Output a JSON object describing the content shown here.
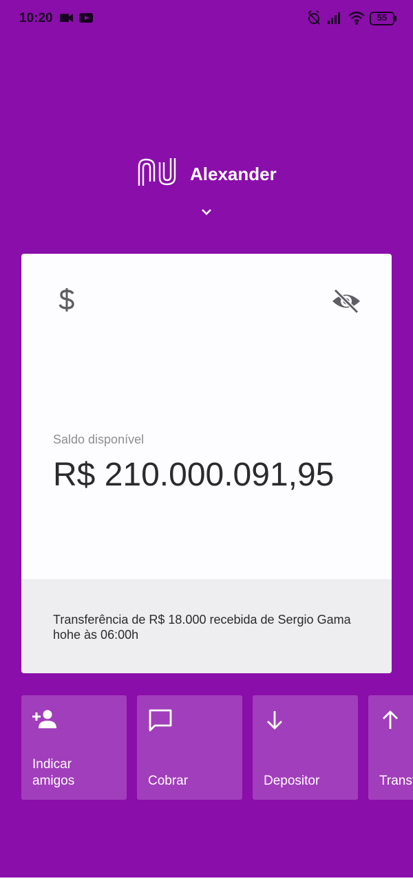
{
  "status_bar": {
    "time": "10:20",
    "battery": "55",
    "icons": [
      "video-camera-icon",
      "youtube-icon",
      "alarm-off-icon",
      "signal-icon",
      "wifi-icon",
      "battery-icon"
    ]
  },
  "header": {
    "user_name": "Alexander",
    "logo": "nu-logo",
    "expand_icon": "chevron-down-icon"
  },
  "account_card": {
    "icon": "dollar-icon",
    "visibility_icon": "eye-off-icon",
    "balance_label": "Saldo disponível",
    "balance_value": "R$ 210.000.091,95",
    "notification": "Transferência de R$ 18.000 recebida de Sergio Gama hohe às 06:00h"
  },
  "actions": [
    {
      "label": "Indicar\namigos",
      "icon": "person-add-icon"
    },
    {
      "label": "Cobrar",
      "icon": "chat-icon"
    },
    {
      "label": "Depositor",
      "icon": "arrow-down-icon"
    },
    {
      "label": "Transferir",
      "icon": "arrow-up-icon"
    }
  ],
  "colors": {
    "brand_purple": "#8a0eaa",
    "card_bg": "#fdfcfe",
    "card_footer_bg": "#eeedef",
    "text_dark": "#2b2b2e",
    "text_muted": "#8e8e92"
  }
}
